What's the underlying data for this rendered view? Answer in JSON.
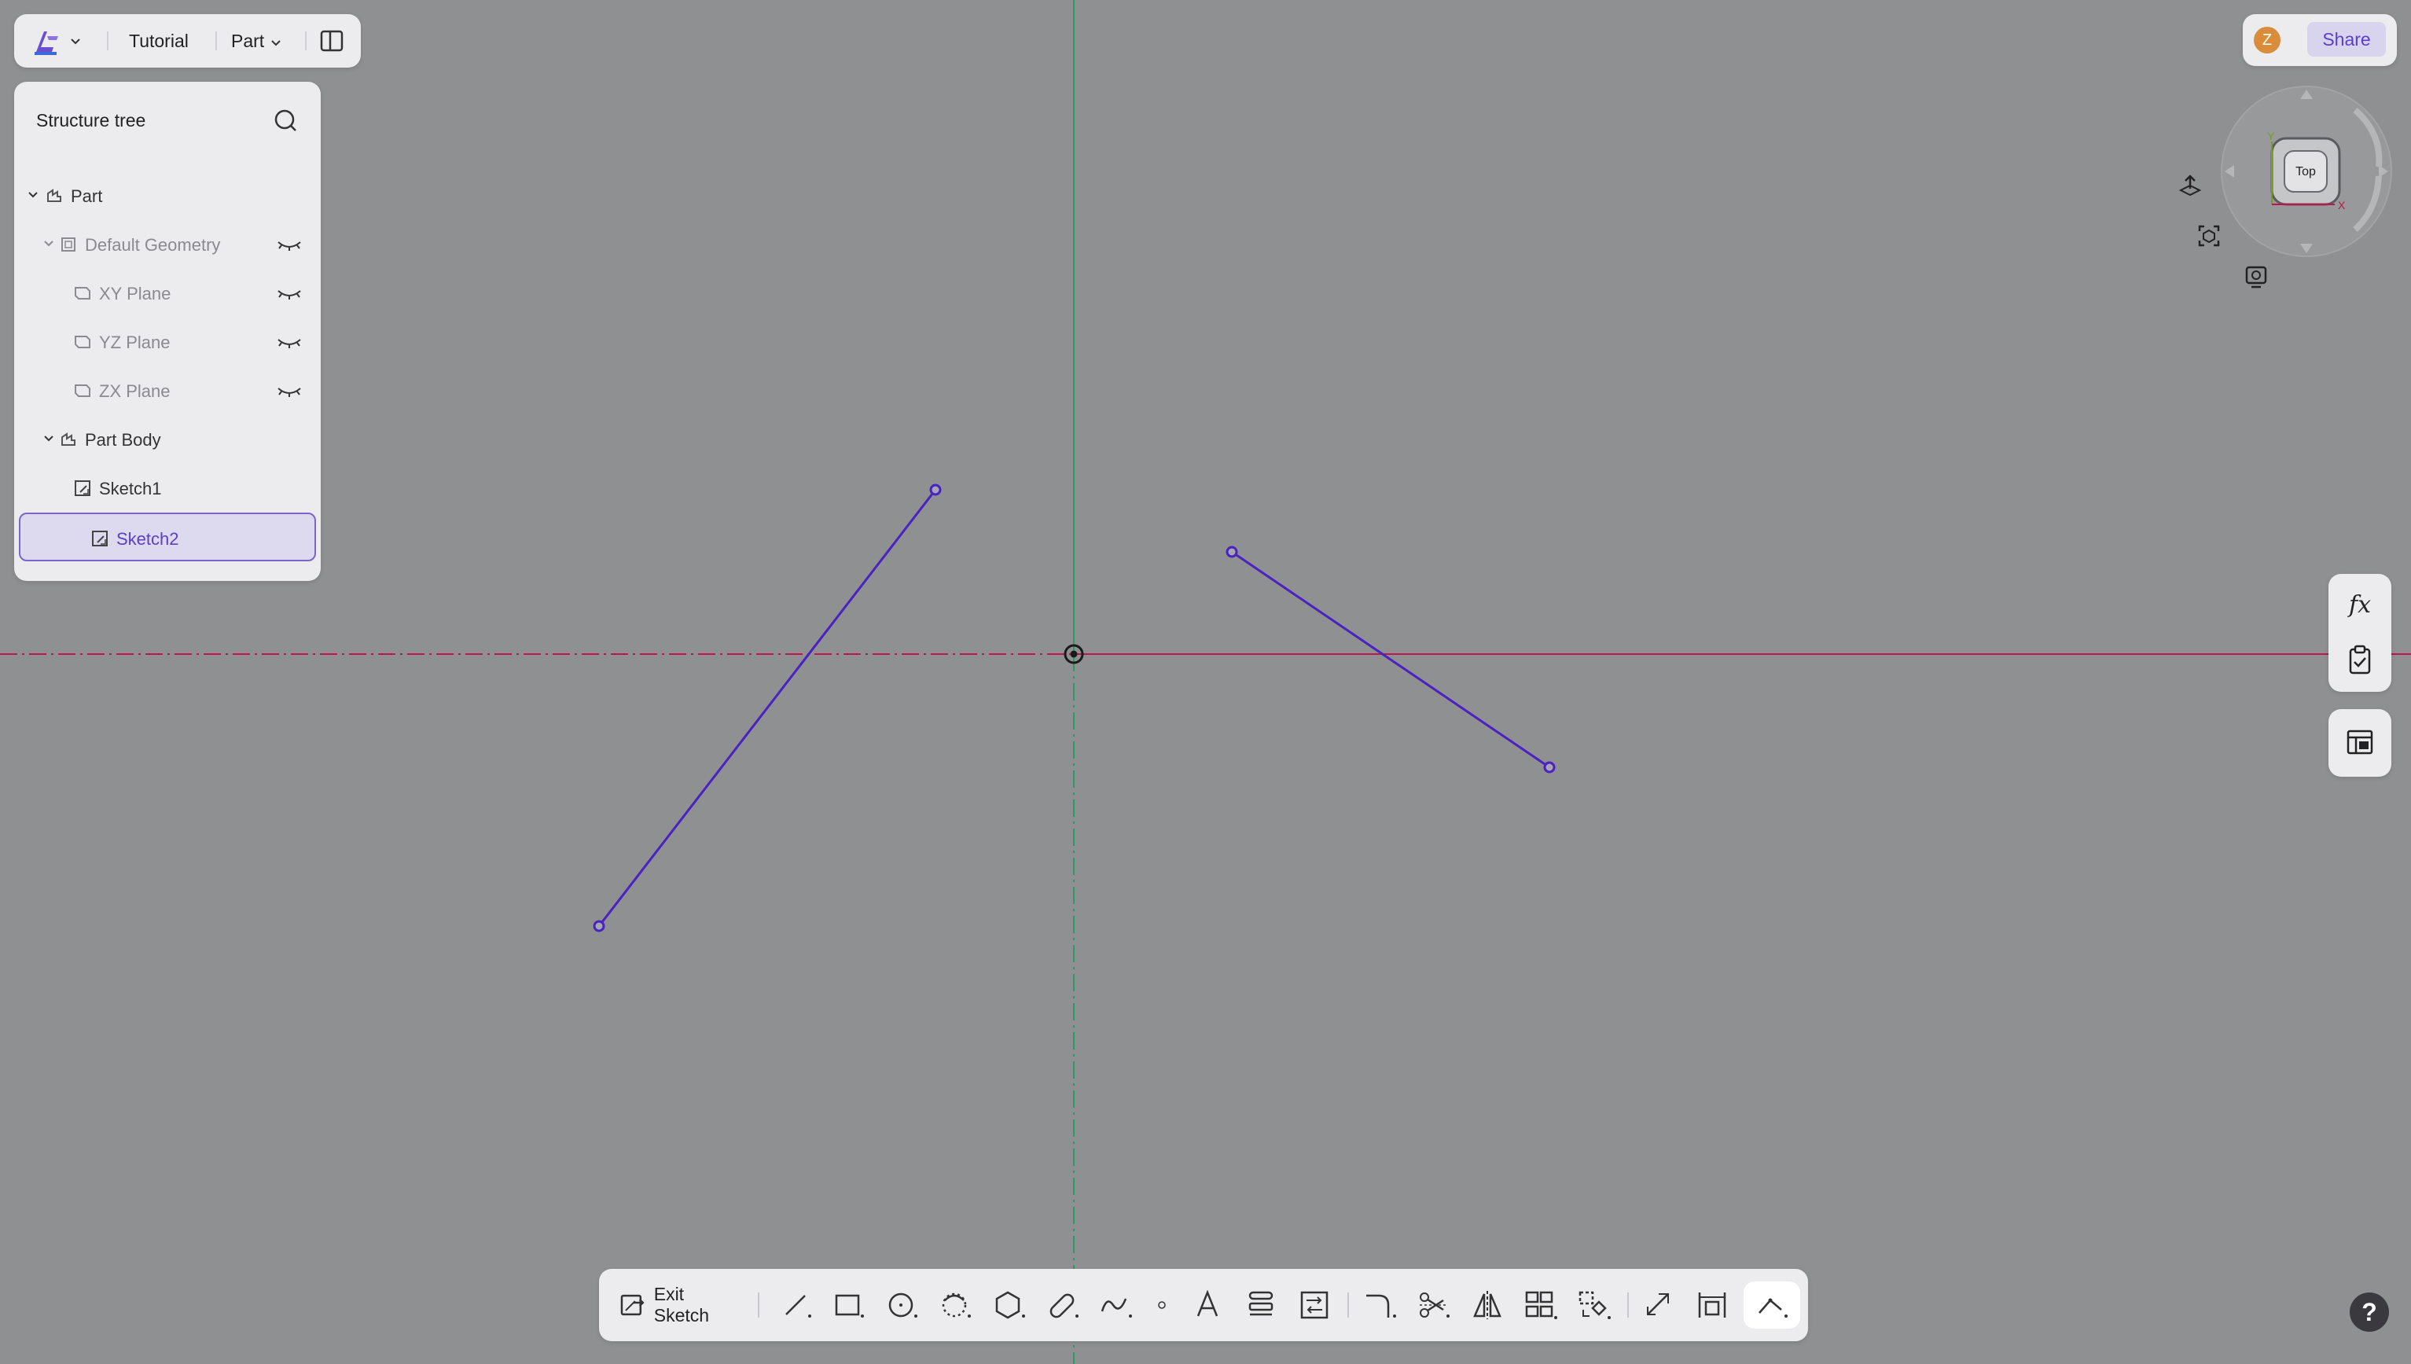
{
  "app": {
    "project_name": "Tutorial",
    "mode_label": "Part",
    "share_label": "Share",
    "user_initial": "Z"
  },
  "structure_tree": {
    "title": "Structure tree",
    "items": [
      {
        "label": "Part"
      },
      {
        "label": "Default Geometry"
      },
      {
        "label": "XY Plane"
      },
      {
        "label": "YZ Plane"
      },
      {
        "label": "ZX Plane"
      },
      {
        "label": "Part Body"
      },
      {
        "label": "Sketch1"
      },
      {
        "label": "Sketch2",
        "selected": true
      }
    ]
  },
  "view_cube": {
    "face_label": "Top",
    "axis_y": "Y",
    "axis_x": "X"
  },
  "right_tools": {
    "formula_label": "fx"
  },
  "toolbar": {
    "exit_sketch_label": "Exit Sketch",
    "tools": [
      "line-tool",
      "rectangle-tool",
      "circle-tool",
      "arc-tool",
      "polygon-tool",
      "slot-tool",
      "spline-tool",
      "point-tool",
      "text-tool",
      "offset-tool",
      "convert-tool",
      "fillet-tool",
      "trim-tool",
      "mirror-tool",
      "pattern-tool",
      "transform-tool",
      "construction-tool",
      "dimension-tool",
      "constraint-tool"
    ],
    "active_tool": "constraint-tool"
  },
  "help_label": "?",
  "colors": {
    "background": "#8f9092",
    "sketch_line": "#4a22c0",
    "x_axis": "#c0144a",
    "y_axis": "#2a9a6a",
    "accent": "#5b3fc4"
  }
}
